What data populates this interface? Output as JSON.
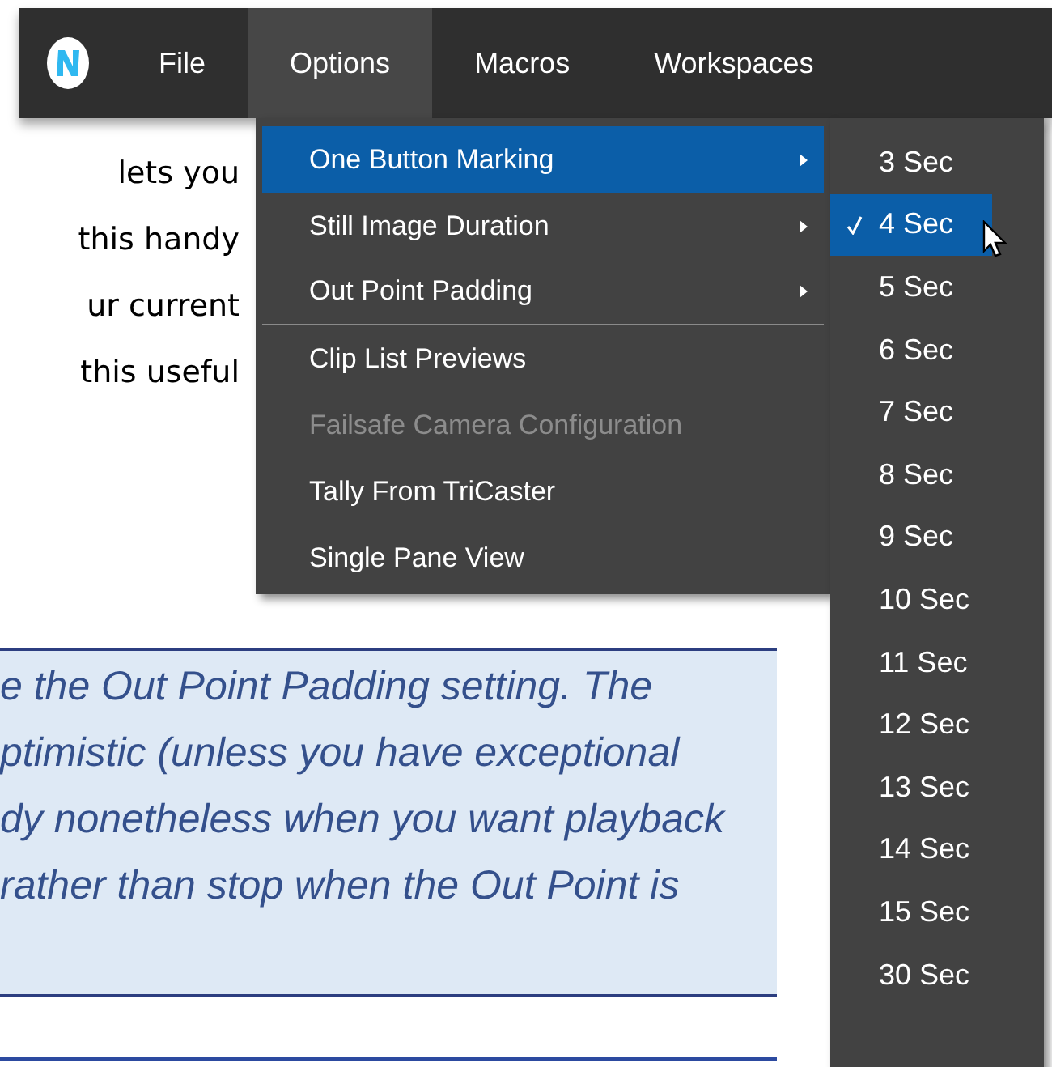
{
  "menu_bar": {
    "items": [
      {
        "label": "File",
        "selected": false
      },
      {
        "label": "Options",
        "selected": true
      },
      {
        "label": "Macros",
        "selected": false
      },
      {
        "label": "Workspaces",
        "selected": false
      }
    ]
  },
  "body_text": {
    "lines": [
      "lets you",
      "this handy",
      "ur current",
      "this useful"
    ]
  },
  "note": {
    "lines": [
      "e the Out Point Padding setting.  The",
      "ptimistic (unless you have exceptional",
      "dy nonetheless when you want playback",
      "rather than stop when the Out Point is"
    ]
  },
  "options_menu": {
    "items": [
      {
        "label": "One Button Marking",
        "submenu": true,
        "selected": true,
        "disabled": false,
        "separator_after": false
      },
      {
        "label": "Still Image Duration",
        "submenu": true,
        "selected": false,
        "disabled": false,
        "separator_after": false
      },
      {
        "label": "Out Point Padding",
        "submenu": true,
        "selected": false,
        "disabled": false,
        "separator_after": true
      },
      {
        "label": "Clip List Previews",
        "submenu": false,
        "selected": false,
        "disabled": false,
        "separator_after": false
      },
      {
        "label": "Failsafe Camera Configuration",
        "submenu": false,
        "selected": false,
        "disabled": true,
        "separator_after": false
      },
      {
        "label": "Tally From TriCaster",
        "submenu": false,
        "selected": false,
        "disabled": false,
        "separator_after": false
      },
      {
        "label": "Single Pane View",
        "submenu": false,
        "selected": false,
        "disabled": false,
        "separator_after": false
      }
    ]
  },
  "submenu": {
    "items": [
      {
        "label": "3 Sec",
        "checked": false,
        "selected": false
      },
      {
        "label": "4 Sec",
        "checked": true,
        "selected": true
      },
      {
        "label": "5 Sec",
        "checked": false,
        "selected": false
      },
      {
        "label": "6 Sec",
        "checked": false,
        "selected": false
      },
      {
        "label": "7 Sec",
        "checked": false,
        "selected": false
      },
      {
        "label": "8 Sec",
        "checked": false,
        "selected": false
      },
      {
        "label": "9 Sec",
        "checked": false,
        "selected": false
      },
      {
        "label": "10 Sec",
        "checked": false,
        "selected": false
      },
      {
        "label": "11 Sec",
        "checked": false,
        "selected": false
      },
      {
        "label": "12 Sec",
        "checked": false,
        "selected": false
      },
      {
        "label": "13 Sec",
        "checked": false,
        "selected": false
      },
      {
        "label": "14 Sec",
        "checked": false,
        "selected": false
      },
      {
        "label": "15 Sec",
        "checked": false,
        "selected": false
      },
      {
        "label": "30 Sec",
        "checked": false,
        "selected": false
      }
    ]
  }
}
